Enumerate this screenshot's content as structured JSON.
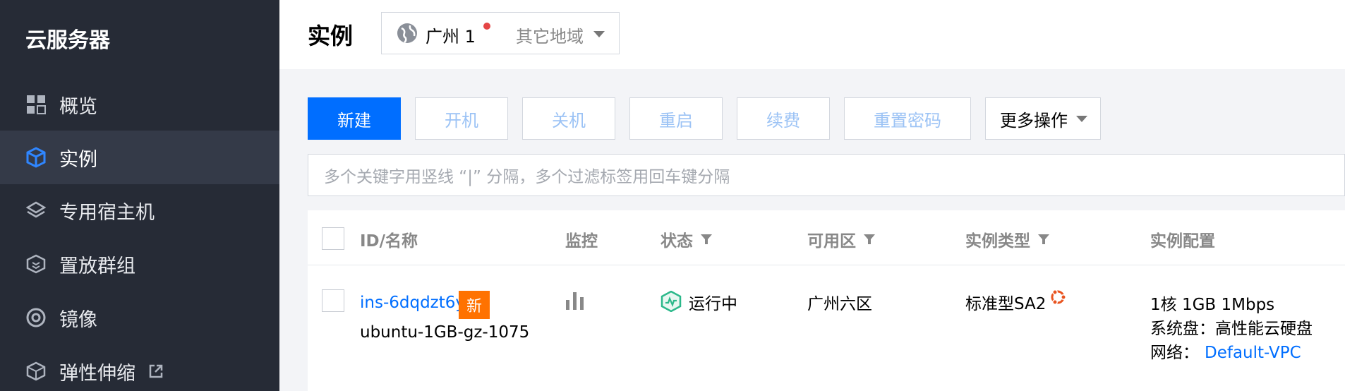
{
  "sidebar": {
    "title": "云服务器",
    "items": [
      {
        "label": "概览",
        "icon": "grid-icon"
      },
      {
        "label": "实例",
        "icon": "cube-icon",
        "active": true
      },
      {
        "label": "专用宿主机",
        "icon": "layers-icon"
      },
      {
        "label": "置放群组",
        "icon": "placement-group-icon"
      },
      {
        "label": "镜像",
        "icon": "image-disc-icon"
      },
      {
        "label": "弹性伸缩",
        "icon": "scaling-icon",
        "external": true
      }
    ]
  },
  "header": {
    "title": "实例",
    "region": {
      "active": "广州 1",
      "other": "其它地域",
      "icon": "globe-icon",
      "dot_color": "#e54545"
    }
  },
  "toolbar": {
    "buttons": [
      "新建",
      "开机",
      "关机",
      "重启",
      "续费",
      "重置密码"
    ],
    "more": "更多操作"
  },
  "search": {
    "placeholder": "多个关键字用竖线 “|” 分隔，多个过滤标签用回车键分隔"
  },
  "table": {
    "columns": [
      "ID/名称",
      "监控",
      "状态",
      "可用区",
      "实例类型",
      "实例配置"
    ],
    "rows": [
      {
        "id": "ins-6dqdzt6y",
        "badge": "新",
        "name": "ubuntu-1GB-gz-1075",
        "status": "运行中",
        "zone": "广州六区",
        "type": "标准型SA2",
        "config": {
          "spec": "1核 1GB 1Mbps",
          "disk_label": "系统盘：",
          "disk_value": "高性能云硬盘",
          "network_label": "网络：",
          "network_value": "Default-VPC"
        }
      }
    ]
  },
  "colors": {
    "primary": "#006eff",
    "sidebar_bg": "#262b36",
    "badge": "#ff7200",
    "status_green": "#2bb88a"
  }
}
